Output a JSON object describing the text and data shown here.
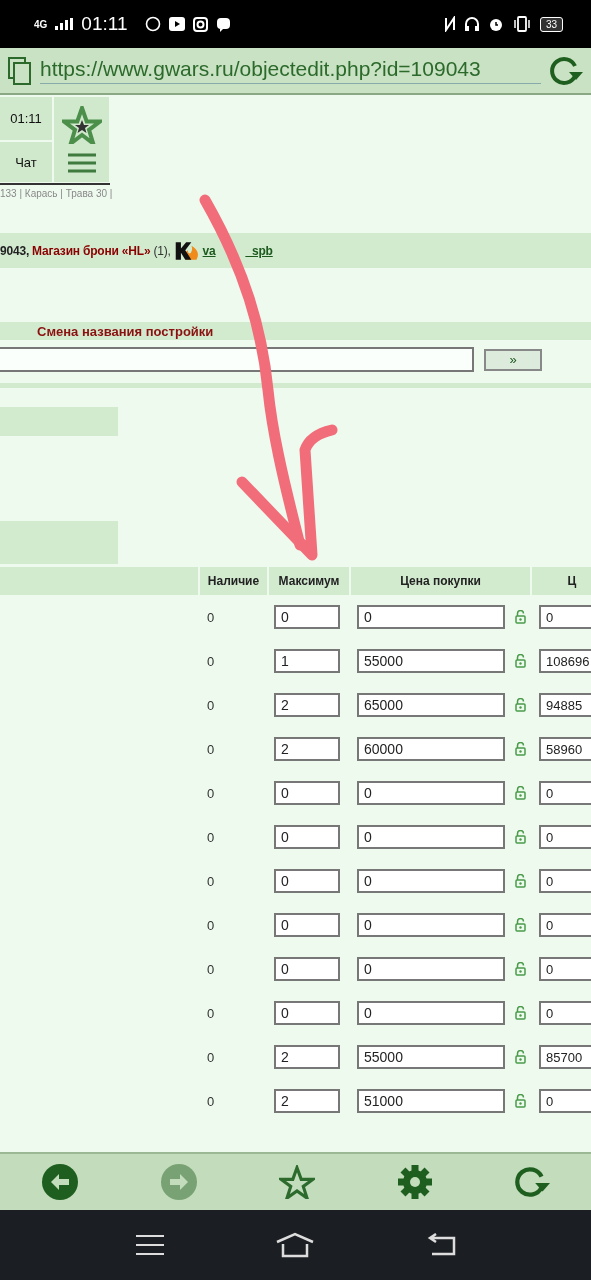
{
  "status_bar": {
    "network": "4G",
    "time": "01:11",
    "battery": "33"
  },
  "address_bar": {
    "url": "https://www.gwars.ru/objectedit.php?id=109043"
  },
  "top_nav": {
    "time": "01:11",
    "chat": "Чат"
  },
  "resources": "133 | Карась | Трава 30 |",
  "building_info": {
    "id": "9043,",
    "name": "Магазин брони «HL»",
    "count": "(1),",
    "owner_start": "va",
    "owner_end": "_spb"
  },
  "rename": {
    "title": "Смена названия постройки",
    "submit": "»"
  },
  "table": {
    "columns": [
      "Наличие",
      "Максимум",
      "Цена покупки",
      "Ц"
    ],
    "rows": [
      {
        "stock": "0",
        "max": "0",
        "buy": "0",
        "column_5": "0"
      },
      {
        "stock": "0",
        "max": "1",
        "buy": "55000",
        "column_5": "108696"
      },
      {
        "stock": "0",
        "max": "2",
        "buy": "65000",
        "column_5": "94885"
      },
      {
        "stock": "0",
        "max": "2",
        "buy": "60000",
        "column_5": "58960"
      },
      {
        "stock": "0",
        "max": "0",
        "buy": "0",
        "column_5": "0"
      },
      {
        "stock": "0",
        "max": "0",
        "buy": "0",
        "column_5": "0"
      },
      {
        "stock": "0",
        "max": "0",
        "buy": "0",
        "column_5": "0"
      },
      {
        "stock": "0",
        "max": "0",
        "buy": "0",
        "column_5": "0"
      },
      {
        "stock": "0",
        "max": "0",
        "buy": "0",
        "column_5": "0"
      },
      {
        "stock": "0",
        "max": "0",
        "buy": "0",
        "column_5": "0"
      },
      {
        "stock": "0",
        "max": "2",
        "buy": "55000",
        "column_5": "85700"
      },
      {
        "stock": "0",
        "max": "2",
        "buy": "51000",
        "column_5": "0"
      }
    ]
  },
  "bottom_nav": {
    "back": {
      "disabled": false
    },
    "forward": {
      "disabled": true
    }
  }
}
